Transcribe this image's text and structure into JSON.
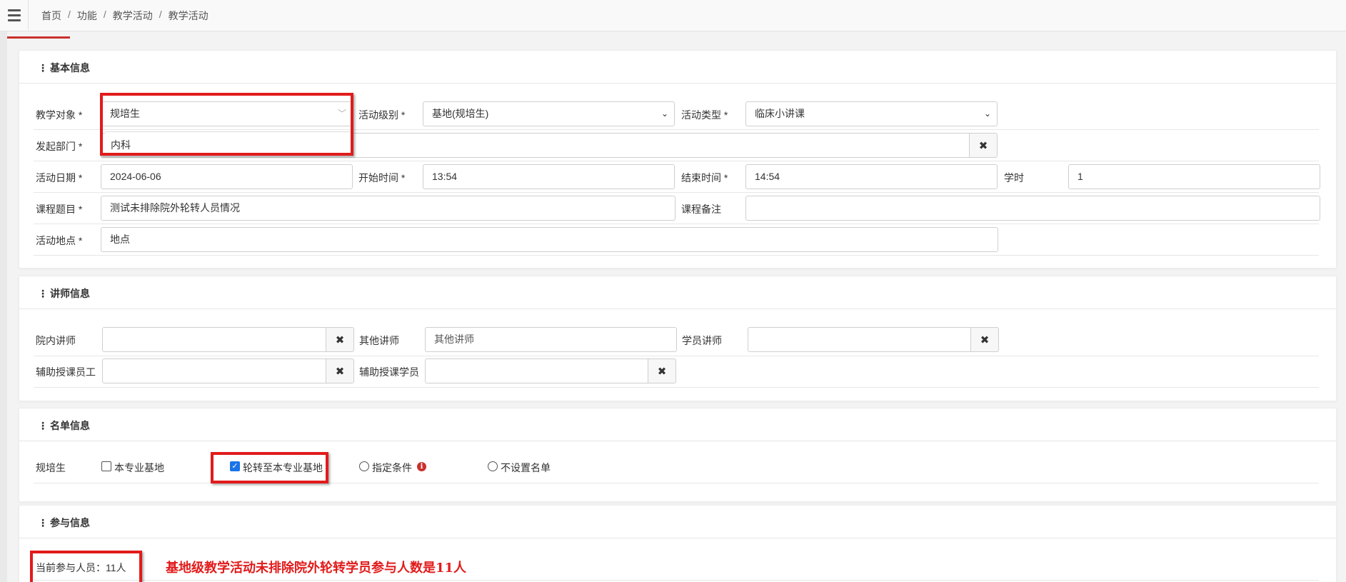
{
  "breadcrumb": [
    "首页",
    "功能",
    "教学活动",
    "教学活动"
  ],
  "basic_info": {
    "title": "基本信息",
    "teaching_target": {
      "label": "教学对象 *",
      "value": "规培生",
      "option": "内科"
    },
    "activity_level": {
      "label": "活动级别 *",
      "value": "基地(规培生)"
    },
    "activity_type": {
      "label": "活动类型 *",
      "value": "临床小讲课"
    },
    "department": {
      "label": "发起部门 *",
      "value": ""
    },
    "activity_date": {
      "label": "活动日期 *",
      "value": "2024-06-06"
    },
    "start_time": {
      "label": "开始时间 *",
      "value": "13:54"
    },
    "end_time": {
      "label": "结束时间 *",
      "value": "14:54"
    },
    "hours": {
      "label": "学时",
      "value": "1"
    },
    "course_title": {
      "label": "课程题目 *",
      "value": "测试未排除院外轮转人员情况"
    },
    "course_remark": {
      "label": "课程备注",
      "value": ""
    },
    "location": {
      "label": "活动地点 *",
      "value": "地点"
    }
  },
  "lecturer_info": {
    "title": "讲师信息",
    "internal_lecturer": {
      "label": "院内讲师",
      "value": ""
    },
    "other_lecturer": {
      "label": "其他讲师",
      "placeholder": "其他讲师"
    },
    "student_lecturer": {
      "label": "学员讲师",
      "value": ""
    },
    "assist_staff": {
      "label": "辅助授课员工",
      "value": ""
    },
    "assist_student": {
      "label": "辅助授课学员",
      "value": ""
    }
  },
  "roster_info": {
    "title": "名单信息",
    "row_label": "规培生",
    "options": [
      {
        "label": "本专业基地",
        "type": "checkbox",
        "checked": false
      },
      {
        "label": "轮转至本专业基地",
        "type": "checkbox",
        "checked": true
      },
      {
        "label": "指定条件",
        "type": "radio",
        "checked": false
      },
      {
        "label": "不设置名单",
        "type": "radio",
        "checked": false
      }
    ]
  },
  "participation_info": {
    "title": "参与信息",
    "current_count": "当前参与人员：11人",
    "annotation": "基地级教学活动未排除院外轮转学员参与人数是11人"
  },
  "colors": {
    "accent_red": "#e21b1b",
    "checkbox_blue": "#1a73e8"
  }
}
